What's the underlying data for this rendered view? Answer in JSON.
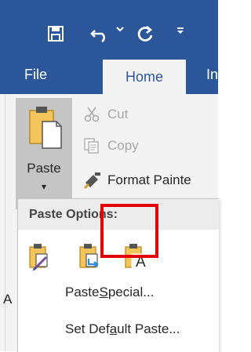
{
  "titlebar": {
    "bg_color": "#2b579a",
    "qat": [
      {
        "name": "save-icon"
      },
      {
        "name": "undo-icon"
      },
      {
        "name": "redo-icon"
      },
      {
        "name": "customize-qat-icon"
      }
    ]
  },
  "tabs": {
    "file": "File",
    "home": "Home",
    "partial": "In"
  },
  "clipboard": {
    "paste_label": "Paste",
    "paste_caret": "▾",
    "cut_label": "Cut",
    "copy_label": "Copy",
    "format_painter_label": "Format Painte"
  },
  "paste_menu": {
    "header": "Paste Options:",
    "options": [
      {
        "icon": "keep-source-formatting-icon"
      },
      {
        "icon": "merge-formatting-icon"
      },
      {
        "icon": "keep-text-only-icon",
        "glyph": "A",
        "highlighted": true
      }
    ],
    "items": [
      {
        "pre": "Paste ",
        "accel": "S",
        "post": "pecial..."
      },
      {
        "pre": "Set Def",
        "accel": "a",
        "post": "ult Paste..."
      }
    ]
  },
  "background_glyph": "A",
  "highlight_color": "#e40000"
}
